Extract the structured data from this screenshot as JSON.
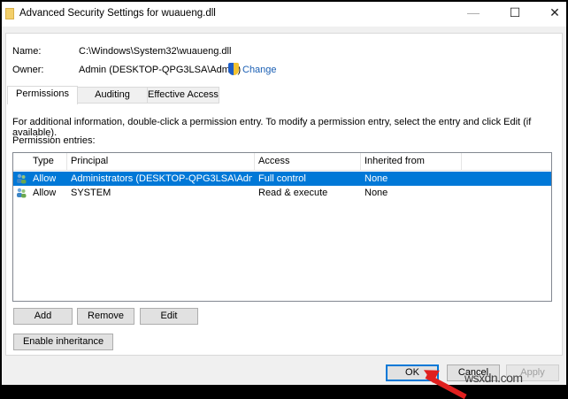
{
  "window": {
    "title": "Advanced Security Settings for wuaueng.dll",
    "minimize": "—",
    "maximize": "☐",
    "close": "✕"
  },
  "info": {
    "name_label": "Name:",
    "name_value": "C:\\Windows\\System32\\wuaueng.dll",
    "owner_label": "Owner:",
    "owner_value": "Admin (DESKTOP-QPG3LSA\\Admin)",
    "change_link": "Change"
  },
  "tabs": [
    {
      "label": "Permissions"
    },
    {
      "label": "Auditing"
    },
    {
      "label": "Effective Access"
    }
  ],
  "permissions": {
    "info_text": "For additional information, double-click a permission entry. To modify a permission entry, select the entry and click Edit (if available).",
    "entries_label": "Permission entries:",
    "columns": [
      "Type",
      "Principal",
      "Access",
      "Inherited from"
    ],
    "rows": [
      {
        "type": "Allow",
        "principal": "Administrators (DESKTOP-QPG3LSA\\Admin...",
        "access": "Full control",
        "inherited": "None"
      },
      {
        "type": "Allow",
        "principal": "SYSTEM",
        "access": "Read & execute",
        "inherited": "None"
      }
    ],
    "add": "Add",
    "remove": "Remove",
    "edit": "Edit",
    "enable_inheritance": "Enable inheritance"
  },
  "footer": {
    "ok": "OK",
    "cancel": "Cancel",
    "apply": "Apply"
  },
  "watermark": "wsxdn.com",
  "colors": {
    "selection": "#0078d7",
    "link": "#1a5fb4",
    "arrow": "#e0201f"
  }
}
